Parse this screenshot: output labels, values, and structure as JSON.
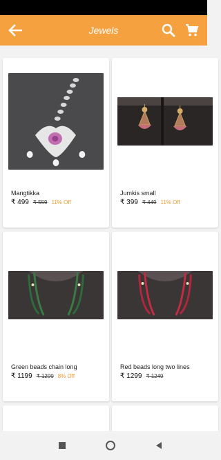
{
  "app_bar": {
    "title": "Jewels",
    "back_icon": "arrow-left-icon",
    "search_icon": "search-icon",
    "cart_icon": "cart-icon",
    "accent": "#f5a13f"
  },
  "products": [
    {
      "name": "Mangtikka",
      "price": "₹ 499",
      "mrp": "₹ 559",
      "off": "11% Off"
    },
    {
      "name": "Jumkis small",
      "price": "₹ 399",
      "mrp": "₹ 449",
      "off": "11% Off"
    },
    {
      "name": "Green beads chain long",
      "price": "₹ 1199",
      "mrp": "₹ 1299",
      "off": "8% Off"
    },
    {
      "name": "Red beads long two lines",
      "price": "₹ 1299",
      "mrp": "₹ 1249",
      "off": ""
    }
  ],
  "nav_bar": {
    "recents_icon": "square-icon",
    "home_icon": "circle-icon",
    "back_icon": "triangle-back-icon"
  }
}
